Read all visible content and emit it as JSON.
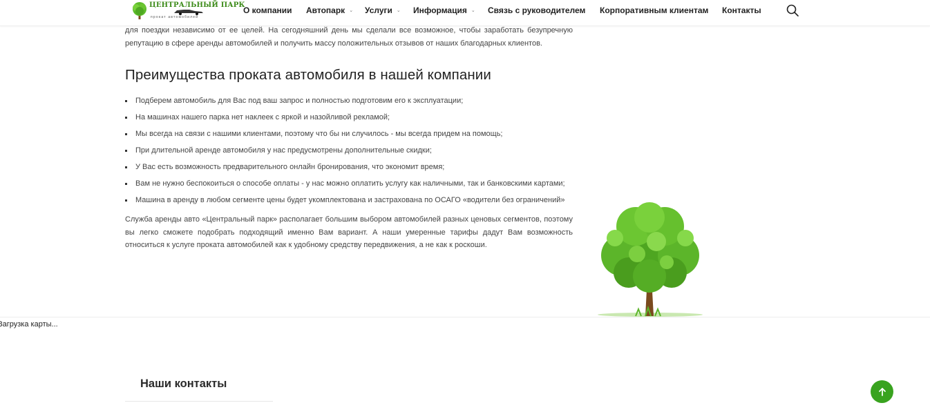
{
  "header": {
    "logo": {
      "title": "ЦЕНТРАЛЬНЫЙ ПАРК",
      "subtitle": "прокат автомобилей"
    },
    "nav": [
      {
        "label": "О компании",
        "dropdown": false
      },
      {
        "label": "Автопарк",
        "dropdown": true
      },
      {
        "label": "Услуги",
        "dropdown": true
      },
      {
        "label": "Информация",
        "dropdown": true
      },
      {
        "label": "Связь с руководителем",
        "dropdown": false
      },
      {
        "label": "Корпоративным клиентам",
        "dropdown": false
      },
      {
        "label": "Контакты",
        "dropdown": false
      }
    ],
    "search_icon": "search-icon"
  },
  "main": {
    "intro": "для поездки независимо от ее целей. На сегодняшний день мы сделали все возможное, чтобы заработать безупречную репутацию в сфере аренды автомобилей и получить массу положительных отзывов от наших благодарных клиентов.",
    "heading": "Преимущества проката автомобиля в нашей компании",
    "benefits": [
      "Подберем автомобиль для Вас под ваш запрос и полностью подготовим его к эксплуатации;",
      "На машинах нашего парка нет наклеек с яркой и назойливой рекламой;",
      "Мы всегда на связи с нашими клиентами, поэтому что бы ни случилось - мы всегда придем на помощь;",
      "При длительной аренде автомобиля у нас предусмотрены дополнительные скидки;",
      "У Вас есть возможность предварительного онлайн бронирования, что экономит время;",
      "Вам не нужно беспокоиться о способе оплаты - у нас можно оплатить услугу как наличными, так и банковскими картами;",
      "Машина в аренду в любом сегменте цены будет укомплектована и застрахована по ОСАГО «водители без ограничений»"
    ],
    "outro": "Служба аренды авто «Центральный парк» располагает большим выбором автомобилей разных ценовых сегментов, поэтому вы легко сможете подобрать подходящий именно Вам вариант. А наши умеренные тарифы дадут Вам возможность относиться к услуге проката автомобилей как к удобному средству передвижения, а не как к роскоши."
  },
  "map": {
    "loading_text": "Загрузка карты..."
  },
  "contacts": {
    "title": "Наши контакты"
  },
  "scroll_top": {
    "icon": "arrow-up-icon"
  },
  "colors": {
    "accent": "#39a31f",
    "logo_green": "#3d8b1a"
  }
}
